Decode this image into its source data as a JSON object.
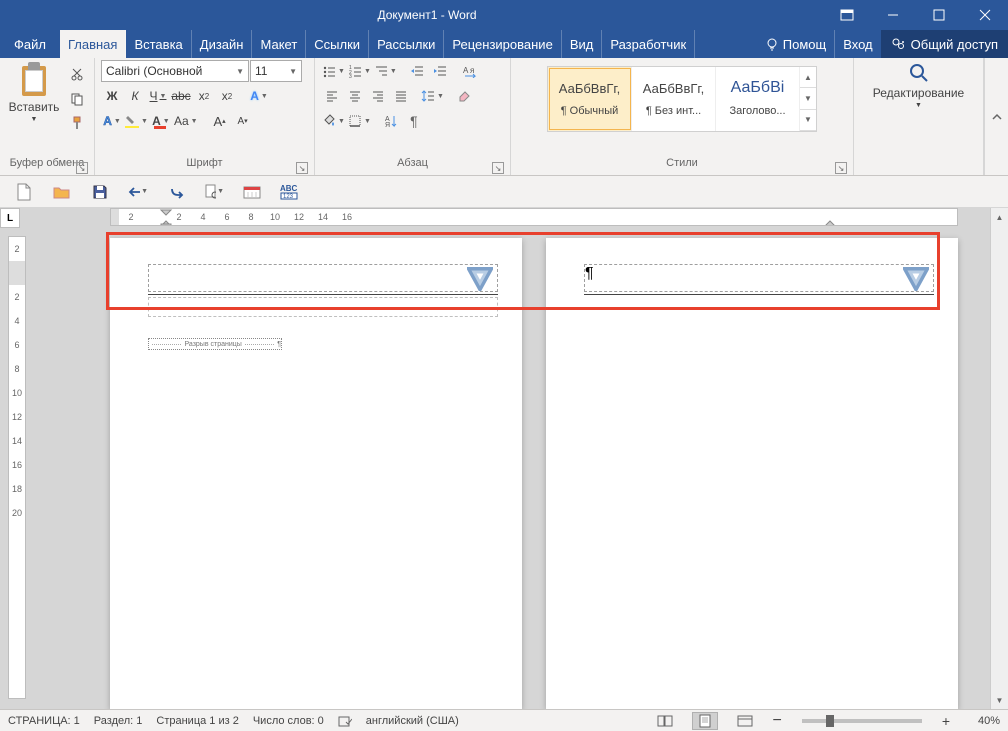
{
  "title": "Документ1 - Word",
  "tabs": {
    "file": "Файл",
    "items": [
      "Главная",
      "Вставка",
      "Дизайн",
      "Макет",
      "Ссылки",
      "Рассылки",
      "Рецензирование",
      "Вид",
      "Разработчик"
    ],
    "active": 0,
    "help": "Помощ",
    "login": "Вход",
    "share": "Общий доступ"
  },
  "ribbon": {
    "clipboard": {
      "paste": "Вставить",
      "label": "Буфер обмена"
    },
    "font": {
      "name": "Calibri (Основной",
      "size": "11",
      "bold": "Ж",
      "italic": "К",
      "underline": "Ч",
      "strike": "abc",
      "label": "Шрифт"
    },
    "paragraph": {
      "label": "Абзац"
    },
    "styles": {
      "label": "Стили",
      "items": [
        {
          "preview": "АаБбВвГг,",
          "name": "¶ Обычный",
          "selected": true
        },
        {
          "preview": "АаБбВвГг,",
          "name": "¶ Без инт...",
          "selected": false
        },
        {
          "preview": "АаБбВі",
          "name": "Заголово...",
          "heading": true
        }
      ]
    },
    "editing": {
      "label": "Редактирование"
    }
  },
  "ruler_h": [
    "2",
    "",
    "2",
    "4",
    "6",
    "8",
    "10",
    "12",
    "14",
    "16"
  ],
  "ruler_v": [
    "2",
    "",
    "2",
    "4",
    "6",
    "8",
    "10",
    "12",
    "14",
    "16",
    "18",
    "20"
  ],
  "document": {
    "page_break": "Разрыв страницы"
  },
  "status": {
    "page": "СТРАНИЦА: 1",
    "section": "Раздел: 1",
    "pages": "Страница 1 из 2",
    "words": "Число слов: 0",
    "language": "английский (США)",
    "zoom": "40%"
  }
}
